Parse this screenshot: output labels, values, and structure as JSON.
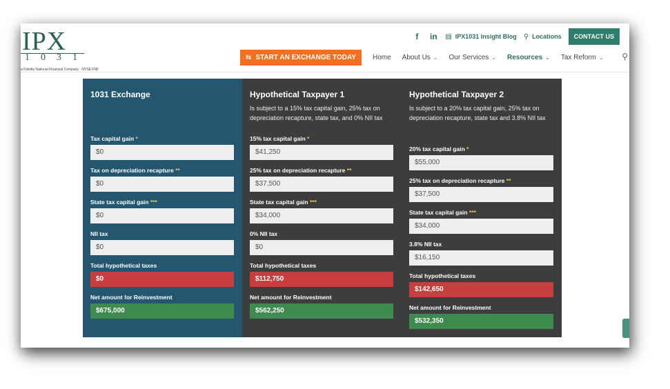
{
  "header": {
    "logo": {
      "main": "IPX",
      "sub": "1031",
      "tagline": "a Fidelity National Financial Company · NYSE:FNF"
    },
    "social": {
      "facebook": "f",
      "linkedin": "in"
    },
    "blog_label": "IPX1031 Insight Blog",
    "locations_label": "Locations",
    "contact_label": "CONTACT US"
  },
  "nav": {
    "start_label": "START AN EXCHANGE TODAY",
    "items": [
      {
        "label": "Home",
        "has_menu": false
      },
      {
        "label": "About Us",
        "has_menu": true
      },
      {
        "label": "Our Services",
        "has_menu": true
      },
      {
        "label": "Resources",
        "has_menu": true,
        "active": true
      },
      {
        "label": "Tax Reform",
        "has_menu": true
      }
    ]
  },
  "calculator": {
    "columns": [
      {
        "title": "1031 Exchange",
        "description": "",
        "fields": [
          {
            "label": "Tax capital gain",
            "stars": "*",
            "value": "$0"
          },
          {
            "label": "Tax on depreciation recapture",
            "stars": "**",
            "value": "$0"
          },
          {
            "label": "State tax capital gain",
            "stars": "***",
            "value": "$0"
          },
          {
            "label": "NII tax",
            "stars": "",
            "value": "$0"
          },
          {
            "label": "Total hypothetical taxes",
            "stars": "",
            "value": "$0"
          },
          {
            "label": "Net amount for Reinvestment",
            "stars": "",
            "value": "$675,000"
          }
        ]
      },
      {
        "title": "Hypothetical Taxpayer 1",
        "description": "Is subject to a 15% tax capital gain, 25% tax on depreciation recapture, state tax, and 0% NII tax",
        "fields": [
          {
            "label": "15% tax capital gain",
            "stars": "*",
            "value": "$41,250"
          },
          {
            "label": "25% tax on depreciation recapture",
            "stars": "**",
            "value": "$37,500"
          },
          {
            "label": "State tax capital gain",
            "stars": "***",
            "value": "$34,000"
          },
          {
            "label": "0% NII tax",
            "stars": "",
            "value": "$0"
          },
          {
            "label": "Total hypothetical taxes",
            "stars": "",
            "value": "$112,750"
          },
          {
            "label": "Net amount for Reinvestment",
            "stars": "",
            "value": "$562,250"
          }
        ]
      },
      {
        "title": "Hypothetical Taxpayer 2",
        "description": "Is subject to a 20% tax capital gain, 25% tax on depreciation recapture, state tax and 3.8% NII tax",
        "fields": [
          {
            "label": "20% tax capital gain",
            "stars": "*",
            "value": "$55,000"
          },
          {
            "label": "25% tax on depreciation recapture",
            "stars": "**",
            "value": "$37,500"
          },
          {
            "label": "State tax capital gain",
            "stars": "***",
            "value": "$34,000"
          },
          {
            "label": "3.8% NII tax",
            "stars": "",
            "value": "$16,150"
          },
          {
            "label": "Total hypothetical taxes",
            "stars": "",
            "value": "$142,650"
          },
          {
            "label": "Net amount for Reinvestment",
            "stars": "",
            "value": "$532,350"
          }
        ]
      }
    ]
  },
  "colors": {
    "brand_green": "#2e6e5c",
    "orange": "#f36f21",
    "column_blue": "#24566f",
    "column_dark": "#3b3d3f",
    "total_red": "#c83e3e",
    "net_green": "#3f8a4f"
  }
}
